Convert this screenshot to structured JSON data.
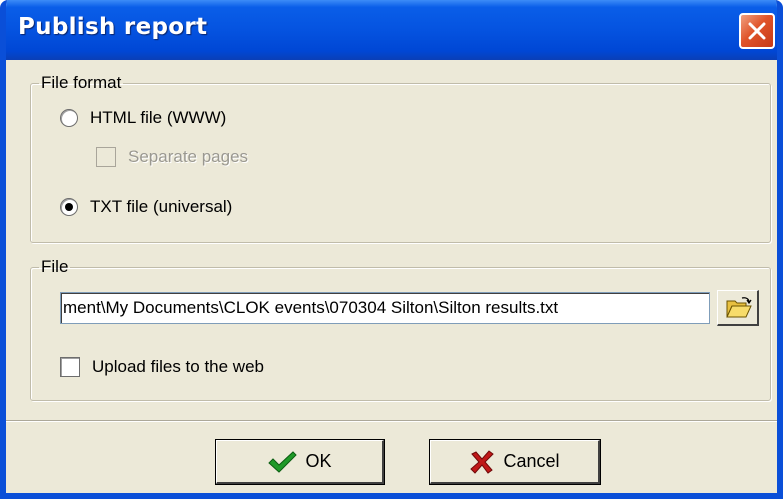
{
  "window": {
    "title": "Publish report"
  },
  "file_format": {
    "legend": "File format",
    "options": [
      {
        "label": "HTML file (WWW)",
        "selected": false
      },
      {
        "label": "TXT file (universal)",
        "selected": true
      }
    ],
    "separate_pages": {
      "label": "Separate pages",
      "checked": false,
      "enabled": false
    }
  },
  "file": {
    "legend": "File",
    "path_value": "ment\\My Documents\\CLOK events\\070304 Silton\\Silton results.txt",
    "browse_icon": "folder-open-icon",
    "upload": {
      "label": "Upload files to the web",
      "checked": false
    }
  },
  "buttons": {
    "ok_label": "OK",
    "ok_icon": "checkmark-icon",
    "cancel_label": "Cancel",
    "cancel_icon": "x-mark-icon"
  },
  "colors": {
    "titlebar": "#0553e0",
    "dialog_face": "#ece9d8",
    "close_button": "#e0542a",
    "ok_check": "#1f9a28",
    "cancel_x": "#c01818"
  }
}
